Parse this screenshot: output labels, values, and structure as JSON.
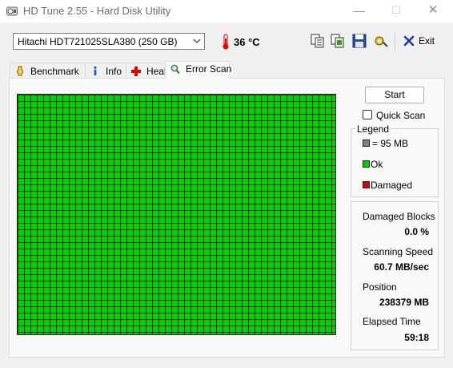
{
  "window": {
    "title": "HD Tune 2.55 - Hard Disk Utility",
    "minimize_glyph": "—",
    "maximize_glyph": "☐",
    "close_glyph": "✕"
  },
  "toolbar": {
    "drive": "Hitachi HDT721025SLA380 (250 GB)",
    "temperature": "36 °C",
    "buttons": [
      "copy-text-icon",
      "copy-screenshot-icon",
      "save-icon",
      "options-icon"
    ],
    "exit_label": "Exit"
  },
  "tabs": [
    {
      "label": "Benchmark",
      "icon": "benchmark-icon",
      "active": false
    },
    {
      "label": "Info",
      "icon": "info-icon",
      "active": false
    },
    {
      "label": "Health",
      "icon": "health-icon",
      "active": false
    },
    {
      "label": "Error Scan",
      "icon": "search-icon",
      "active": true
    }
  ],
  "scan": {
    "start_label": "Start",
    "quick_scan_label": "Quick Scan",
    "quick_scan_checked": false,
    "grid_state": "all blocks ok",
    "block_color": "#00d200"
  },
  "legend": {
    "title": "Legend",
    "items": [
      {
        "label": "= 95 MB",
        "color": "#808080"
      },
      {
        "label": "Ok",
        "color": "#00d200"
      },
      {
        "label": "Damaged",
        "color": "#e00000"
      }
    ]
  },
  "stats": {
    "damaged_blocks_label": "Damaged Blocks",
    "damaged_blocks_value": "0.0 %",
    "scanning_speed_label": "Scanning Speed",
    "scanning_speed_value": "60.7 MB/sec",
    "position_label": "Position",
    "position_value": "238379 MB",
    "elapsed_label": "Elapsed Time",
    "elapsed_value": "59:18"
  }
}
